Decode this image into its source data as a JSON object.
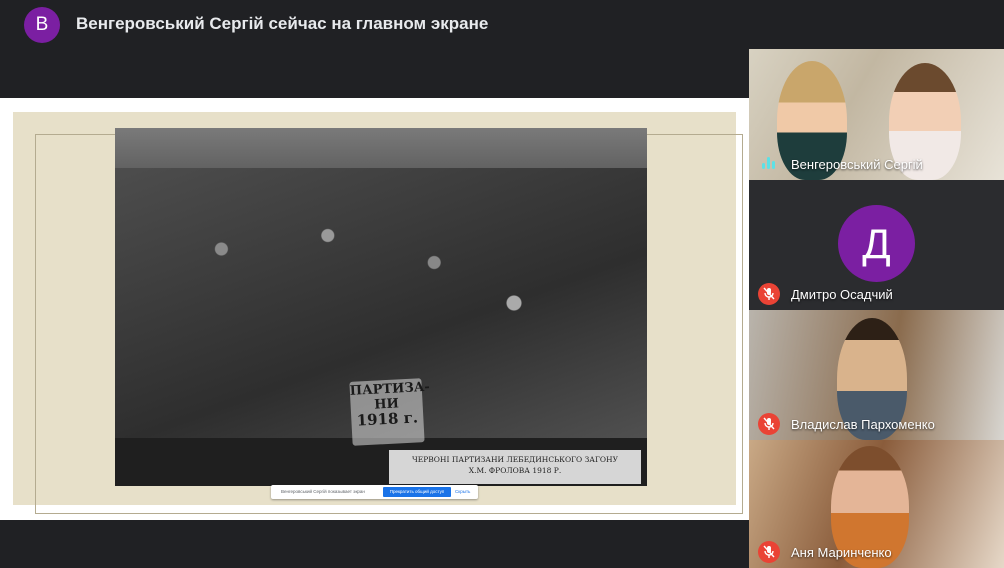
{
  "header": {
    "avatar_letter": "В",
    "title": "Венгеровський Сергій сейчас на главном экране"
  },
  "presentation": {
    "sign_line1": "ПАРТИЗА-",
    "sign_line2": "НИ",
    "sign_year": "1918 г.",
    "plate_line1": "ЧЕРВОНІ ПАРТИЗАНИ ЛЕБЕДИНСЬКОГО ЗАГОНУ",
    "plate_line2": "Х.М. ФРОЛОВА 1918 Р."
  },
  "share_bar": {
    "text": "Венгеровський Сергій показывает экран",
    "share_button": "Прекратить общий доступ",
    "hide_button": "Скрыть"
  },
  "participants": [
    {
      "name": "Венгеровський Сергій",
      "status": "speaking",
      "avatar_letter": ""
    },
    {
      "name": "Дмитро Осадчий",
      "status": "muted",
      "avatar_letter": "Д"
    },
    {
      "name": "Владислав Пархоменко",
      "status": "muted",
      "avatar_letter": ""
    },
    {
      "name": "Аня Маринченко",
      "status": "muted",
      "avatar_letter": ""
    }
  ],
  "colors": {
    "avatar_purple": "#7b1fa2",
    "mute_red": "#ea4335",
    "speaking_teal": "#5ce1e6"
  },
  "icons": {
    "muted": "mic-off-icon",
    "speaking": "audio-level-icon"
  }
}
